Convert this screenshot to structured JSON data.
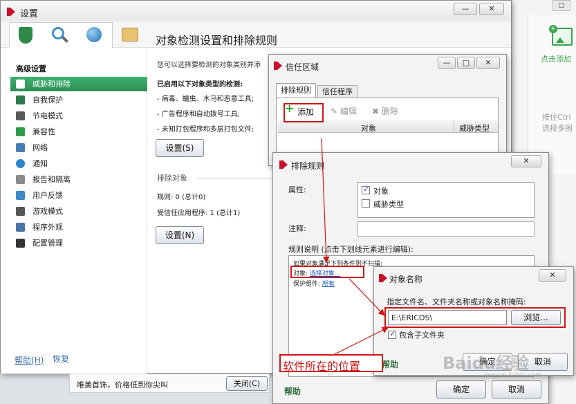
{
  "bg_window": {
    "sidebar_text": "点击添加",
    "hint": "按住Ctrl选择多图"
  },
  "settings": {
    "title": "设置",
    "heading": "对象检测设置和排除规则",
    "intro": "您可以选择要检测的对象类别并添",
    "enabled_label": "已启用以下对象类型的检测:",
    "items": [
      "- 病毒、蠕虫、木马和恶意工具;",
      "- 广告程序和自动拨号工具;",
      "- 未知打包程序和多层打包文件;"
    ],
    "settings_btn1": "设置(S)",
    "exclude_section": "排除对象",
    "rules_count": "规则: 0 (总计0)",
    "trusted_count": "受信任应用程序: 1 (总计1)",
    "settings_btn2": "设置(N)",
    "help_link": "帮助(H)",
    "restore_link": "恢复",
    "nav_header": "高级设置",
    "nav": [
      "威胁和排除",
      "自我保护",
      "节电模式",
      "兼容性",
      "网络",
      "通知",
      "报告和隔离",
      "用户反馈",
      "游戏模式",
      "程序外观",
      "配置管理"
    ],
    "ad_text": "唯美首饰，价格低到你尖叫",
    "ad_close": "关闭(C)"
  },
  "trust": {
    "title": "信任区域",
    "tabs": [
      "排除规则",
      "信任程序"
    ],
    "add": "添加",
    "edit": "编辑",
    "delete": "删除",
    "col_object": "对象",
    "col_threat": "威胁类型"
  },
  "exclusion": {
    "title": "排除规则",
    "property_label": "属性:",
    "opt_object": "对象",
    "opt_threat": "威胁类型",
    "comment_label": "注释:",
    "desc_label": "规则说明 (点击下划线元素进行编辑):",
    "desc_line1": "如果对象满足下列条件则不扫描:",
    "desc_obj_prefix": "对象: ",
    "desc_obj_link": "选择对象...",
    "desc_protect_prefix": "保护组件: ",
    "desc_protect_link": "所有",
    "help": "帮助",
    "help_partial": "帮助",
    "ok": "确定",
    "cancel": "取消"
  },
  "objname": {
    "title": "对象名称",
    "prompt": "指定文件名、文件夹名称或对象名称掩码:",
    "value": "E:\\ERICOS\\",
    "browse": "浏览...",
    "include_sub": "包含子文件夹",
    "ok": "确定",
    "cancel": "取消"
  },
  "annotation": {
    "text": "软件所在的位置"
  },
  "watermark": {
    "text": "Baidu经验",
    "sub": "jingyan.baidu.com"
  }
}
